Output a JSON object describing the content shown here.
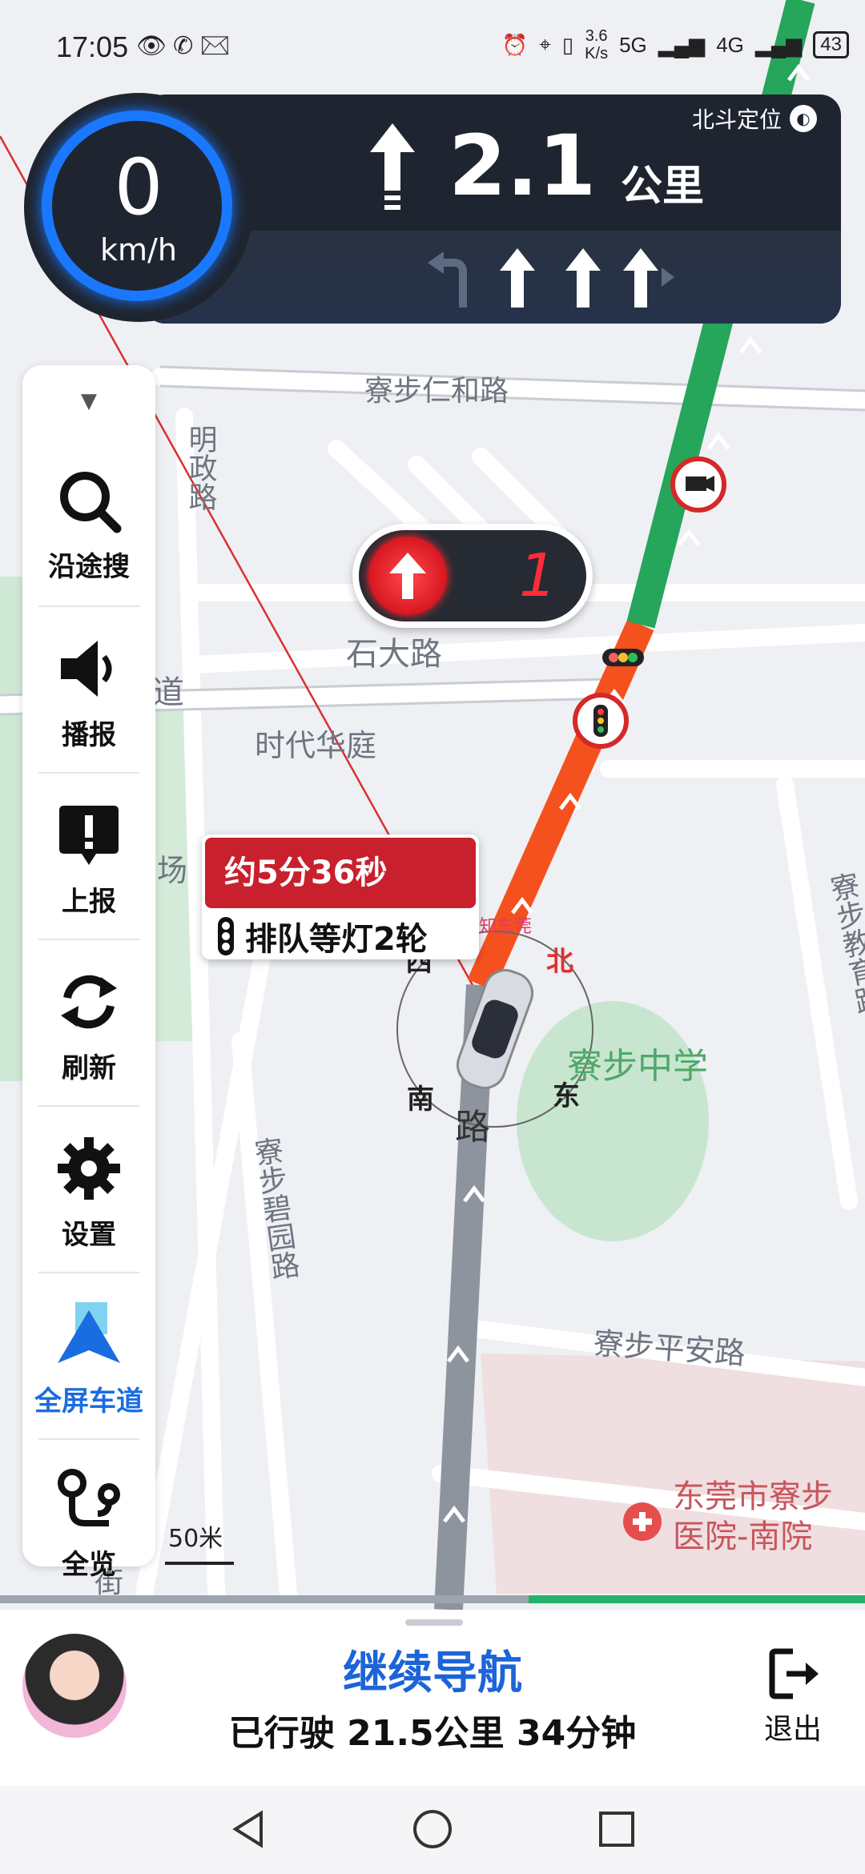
{
  "status_bar": {
    "time": "17:05",
    "left_icons": [
      "eye-icon",
      "missed-call-icon",
      "message-icon"
    ],
    "network_speed_value": "3.6",
    "network_speed_unit": "K/s",
    "signal_1": "5G",
    "signal_2": "4G",
    "battery": "43"
  },
  "nav_header": {
    "speed_value": "0",
    "speed_unit": "km/h",
    "positioning": "北斗定位",
    "distance_value": "2.1",
    "distance_unit": "公里",
    "turn_direction": "straight",
    "lanes": [
      "left-turn",
      "straight",
      "straight",
      "straight-right"
    ]
  },
  "sidebar": {
    "items": [
      {
        "label": "沿途搜",
        "icon": "search-icon"
      },
      {
        "label": "播报",
        "icon": "speaker-icon"
      },
      {
        "label": "上报",
        "icon": "report-icon"
      },
      {
        "label": "刷新",
        "icon": "refresh-icon"
      },
      {
        "label": "设置",
        "icon": "gear-icon"
      },
      {
        "label": "全屏车道",
        "icon": "lane-icon"
      },
      {
        "label": "全览",
        "icon": "overview-icon"
      }
    ]
  },
  "map": {
    "scale": "50米",
    "traffic_light_count": "1",
    "eta": "约5分36秒",
    "queue_info": "排队等灯2轮",
    "compass": {
      "n": "北",
      "s": "南",
      "e": "东",
      "w": "西"
    },
    "watermark": "知东莞",
    "roads": {
      "r1": "寮步仁和路",
      "r2": "石大路",
      "r3": "明政路",
      "r4": "寮步碧园路",
      "r5": "寮步平安路",
      "r6": "寮步教育路",
      "r7": "道",
      "r8": "路",
      "r9": "街"
    },
    "pois": {
      "p1": "时代华庭",
      "p2": "寮步中学",
      "p3_line1": "东莞市寮步",
      "p3_line2": "医院-南院",
      "p4": "场"
    },
    "colors": {
      "congested": "#f4511e",
      "free": "#26a65b",
      "route_gray": "#8e949e"
    }
  },
  "bottom_panel": {
    "continue_label": "继续导航",
    "trip_label": "已行驶",
    "trip_distance": "21.5公里",
    "trip_time": "34分钟",
    "exit_label": "退出"
  },
  "system_nav": [
    "back-icon",
    "home-icon",
    "recents-icon"
  ]
}
